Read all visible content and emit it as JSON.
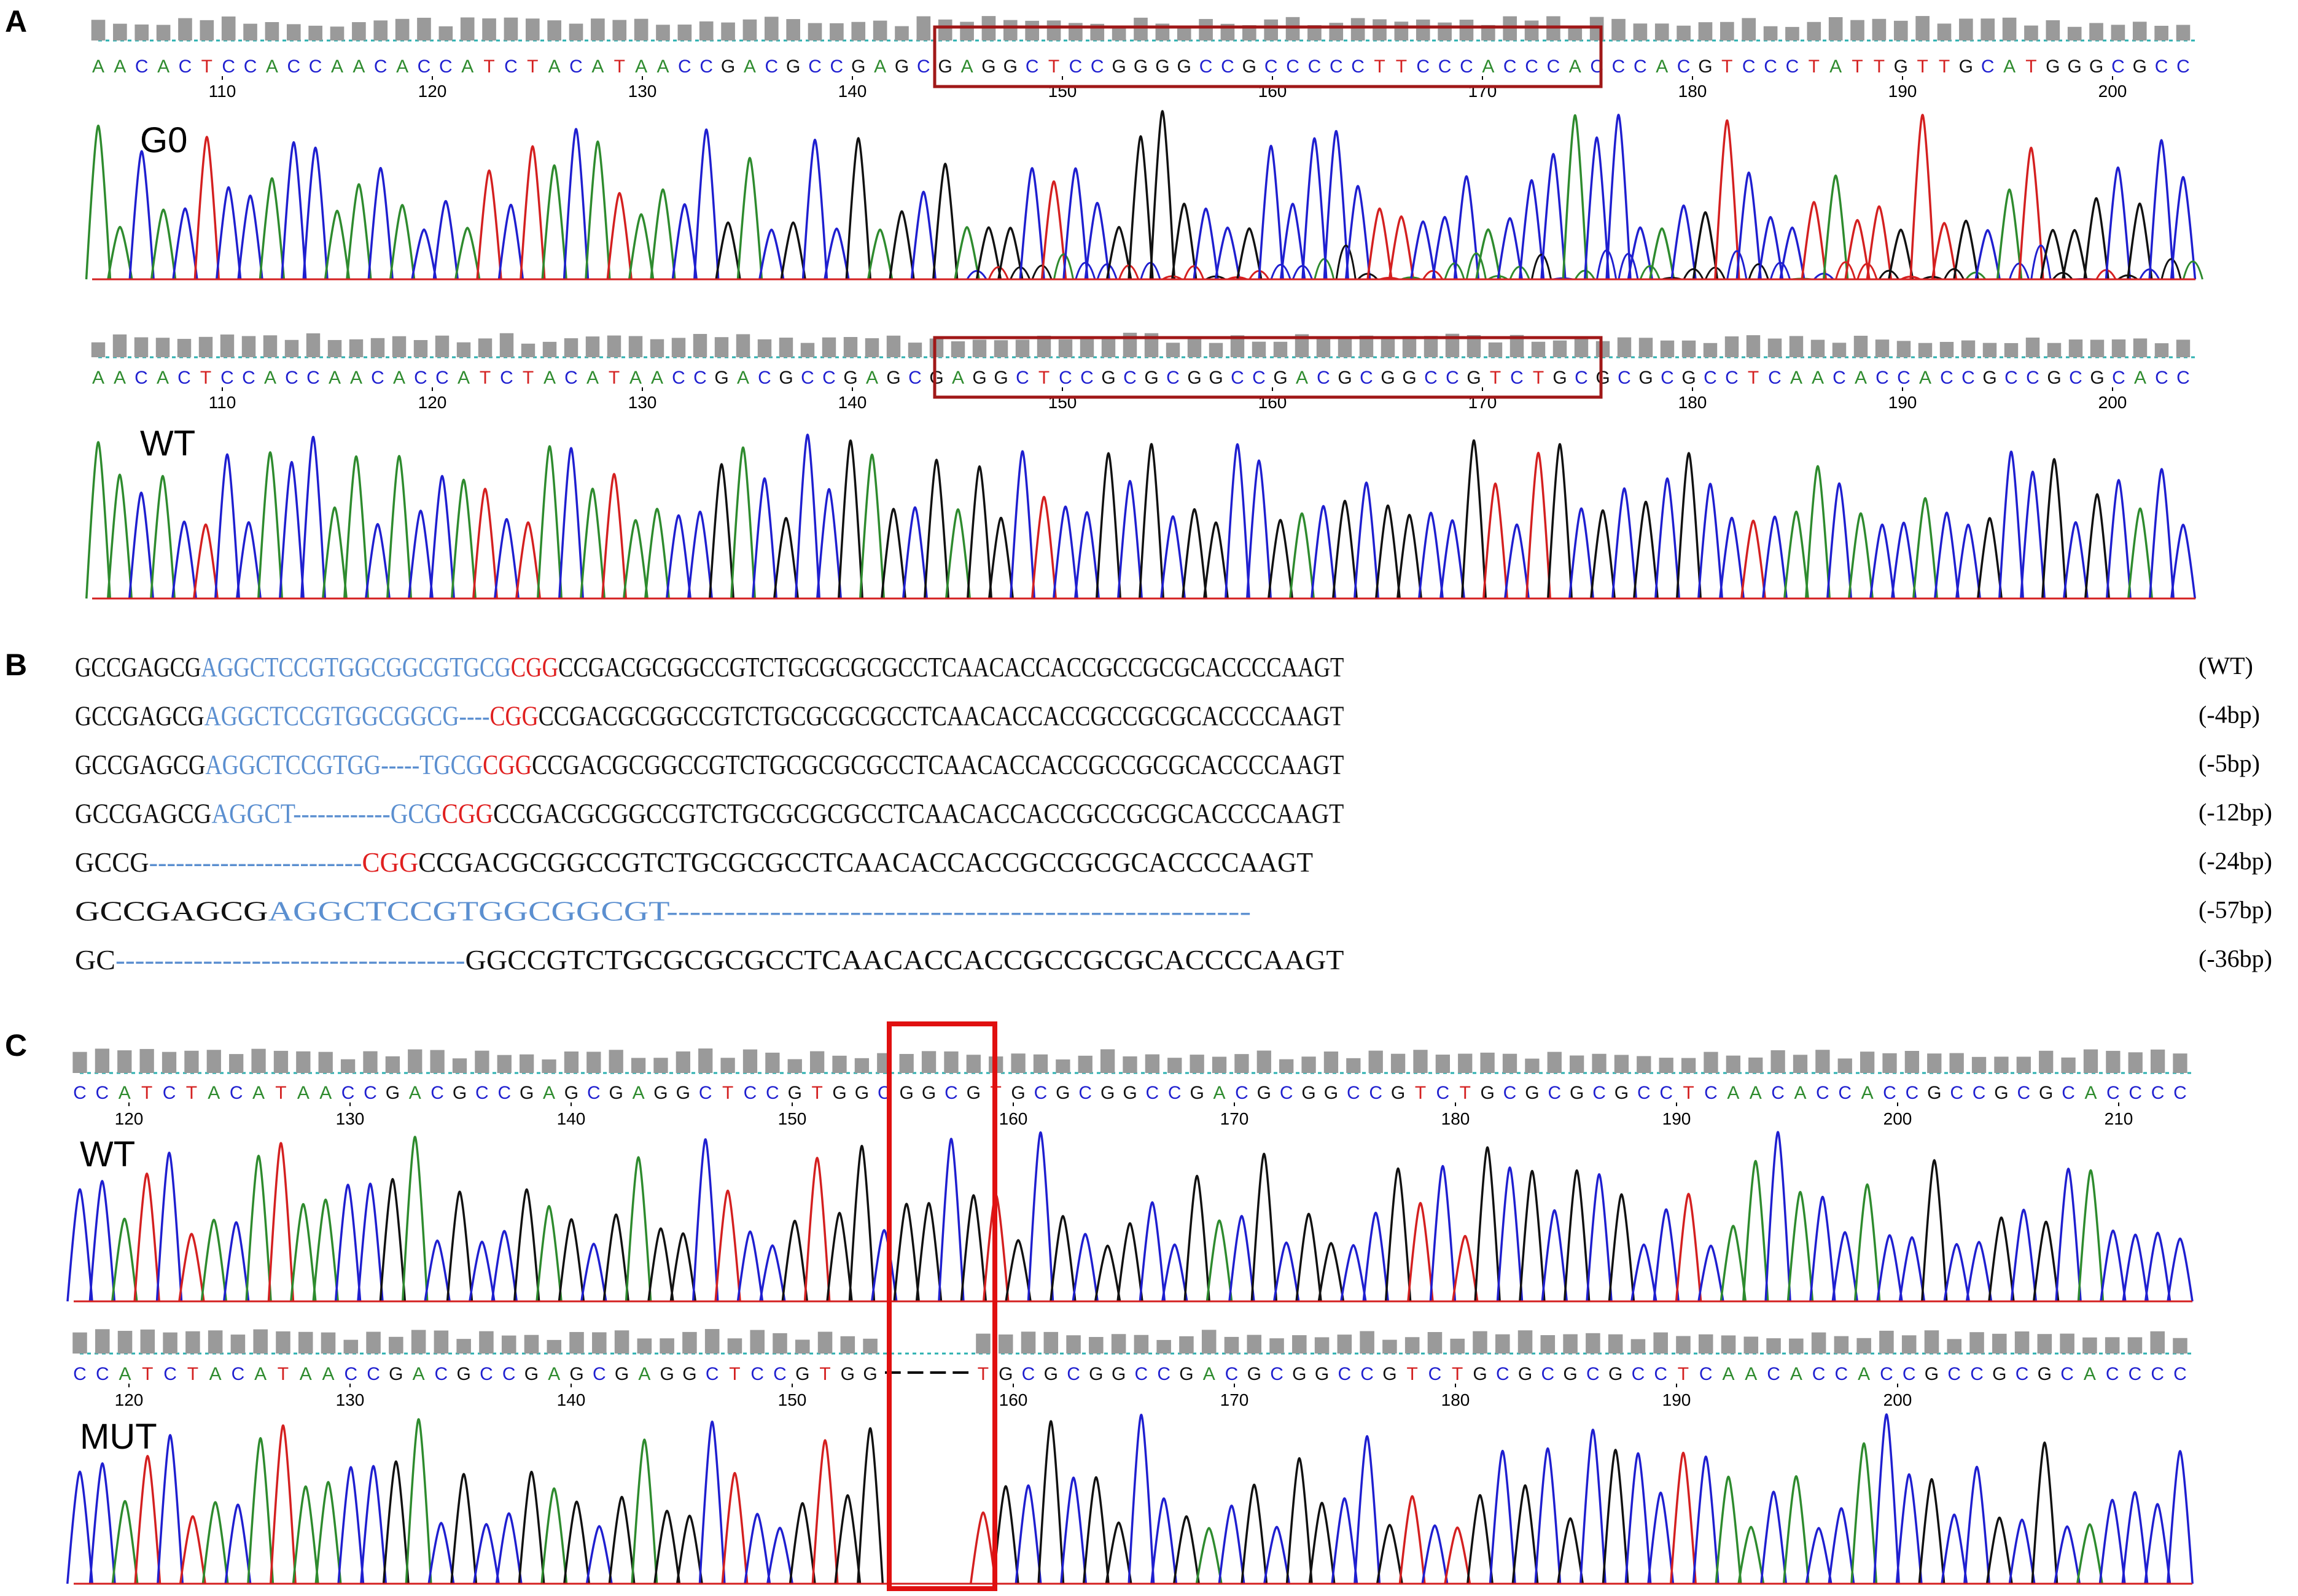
{
  "panels": {
    "A": {
      "label": "A",
      "tracks": [
        {
          "name": "G0",
          "sequence": "AACACTCCACCAACACCATCTACATAACCGACGCCGAGCGAGGCTCCGGGGCCGCCCCCTTCCCACCCACCCACGTCCCTATTGTTGCATGGGCGCC",
          "ticks": [
            "110",
            "120",
            "130",
            "140",
            "150",
            "160",
            "170",
            "180",
            "190",
            "200"
          ]
        },
        {
          "name": "WT",
          "sequence": "AACACTCCACCAACACCATCTACATAACCGACGCCGAGCGAGGCTCCGCGCGGCCGACGCGGCCGTCTGCGCGCGCCTCAACACCACCGCCGCGCACC",
          "ticks": [
            "110",
            "120",
            "130",
            "140",
            "150",
            "160",
            "170",
            "180",
            "190",
            "200"
          ]
        }
      ]
    },
    "B": {
      "label": "B",
      "rows": [
        {
          "segments": [
            {
              "t": "GCCGAGCG",
              "c": "black"
            },
            {
              "t": "AGGCTCCGTGGCGGCGTGCG",
              "c": "blue"
            },
            {
              "t": "CGG",
              "c": "red"
            },
            {
              "t": "CCGACGCGGCCGTCTGCGCGCGCCTCAACACCACCGCCGCGCACCCCAAGT",
              "c": "black"
            }
          ],
          "tag": "(WT)"
        },
        {
          "segments": [
            {
              "t": "GCCGAGCG",
              "c": "black"
            },
            {
              "t": "AGGCTCCGTGGCGGCG----",
              "c": "blue"
            },
            {
              "t": "CGG",
              "c": "red"
            },
            {
              "t": "CCGACGCGGCCGTCTGCGCGCGCCTCAACACCACCGCCGCGCACCCCAAGT",
              "c": "black"
            }
          ],
          "tag": "(-4bp)"
        },
        {
          "segments": [
            {
              "t": "GCCGAGCG",
              "c": "black"
            },
            {
              "t": "AGGCTCCGTGG-----TGCG",
              "c": "blue"
            },
            {
              "t": "CGG",
              "c": "red"
            },
            {
              "t": "CCGACGCGGCCGTCTGCGCGCGCCTCAACACCACCGCCGCGCACCCCAAGT",
              "c": "black"
            }
          ],
          "tag": "(-5bp)"
        },
        {
          "segments": [
            {
              "t": "GCCGAGCG",
              "c": "black"
            },
            {
              "t": "AGGCT------------GCG",
              "c": "blue"
            },
            {
              "t": "CGG",
              "c": "red"
            },
            {
              "t": "CCGACGCGGCCGTCTGCGCGCGCCTCAACACCACCGCCGCGCACCCCAAGT",
              "c": "black"
            }
          ],
          "tag": "(-12bp)"
        },
        {
          "segments": [
            {
              "t": "GCCG",
              "c": "black"
            },
            {
              "t": "------------------------",
              "c": "blue"
            },
            {
              "t": "CGG",
              "c": "red"
            },
            {
              "t": "CCGACGCGGCCGTCTGCGCGCCTCAACACCACCGCCGCGCACCCCAAGT",
              "c": "black"
            }
          ],
          "tag": "(-24bp)"
        },
        {
          "segments": [
            {
              "t": "GCCGAGCG",
              "c": "black"
            },
            {
              "t": "AGGCTCCGTGGCGGCGT---------------------------------------------------",
              "c": "blue"
            }
          ],
          "tag": "(-57bp)"
        },
        {
          "segments": [
            {
              "t": "GC",
              "c": "black"
            },
            {
              "t": "------------------------------------",
              "c": "blue"
            },
            {
              "t": "GGCCGTCTGCGCGCGCCTCAACACCACCGCCGCGCACCCCAAGT",
              "c": "black"
            }
          ],
          "tag": "(-36bp)"
        }
      ]
    },
    "C": {
      "label": "C",
      "tracks": [
        {
          "name": "WT",
          "sequence": "CCATCTACATAACCGACGCCGAGCGAGGCTCCGTGGCGGCGTGCGCGGCCGACGCGGCCGTCTGCGCGCGCCTCAACACCACCGCCGCGCACCCC",
          "ticks": [
            "120",
            "130",
            "140",
            "150",
            "160",
            "170",
            "180",
            "190",
            "200",
            "210"
          ]
        },
        {
          "name": "MUT",
          "sequence": "CCATCTACATAACCGACGCCGAGCGAGGCTCCGTGG----TGCGCGGCCGACGCGGCCGTCTGCGCGCGCCTCAACACCACCGCCGCGCACCCC",
          "ticks": [
            "120",
            "130",
            "140",
            "150",
            "160",
            "170",
            "180",
            "190",
            "200"
          ]
        }
      ]
    }
  },
  "colors": {
    "A": "#2e8b2e",
    "C": "#1f1fd0",
    "G": "#111111",
    "T": "#d42020",
    "blue_text": "#5b8fd0",
    "red_text": "#e02020",
    "box_dark_red": "#a01818",
    "box_red": "#e01010",
    "quality_bar": "#9a9a9a",
    "baseline": "#2ab0b0"
  }
}
